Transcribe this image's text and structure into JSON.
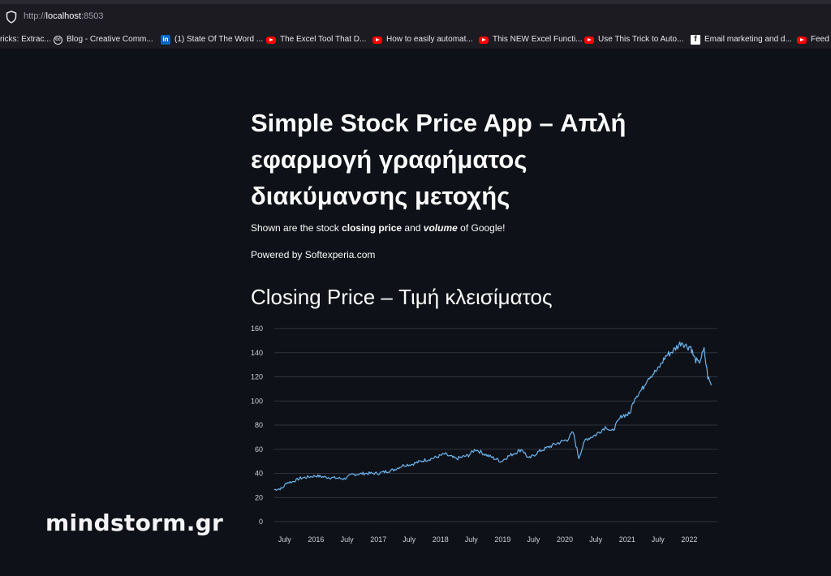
{
  "browser": {
    "url_prefix": "http://",
    "url_host": "localhost",
    "url_port": ":8503",
    "bookmarks": [
      {
        "label": "ricks: Extrac...",
        "icon": "none-icon"
      },
      {
        "label": "Blog - Creative Comm...",
        "icon": "cc-icon"
      },
      {
        "label": "(1) State Of The Word ...",
        "icon": "linkedin-icon"
      },
      {
        "label": "The Excel Tool That D...",
        "icon": "youtube-icon"
      },
      {
        "label": "How to easily automat...",
        "icon": "youtube-icon"
      },
      {
        "label": "This NEW Excel Functi...",
        "icon": "youtube-icon"
      },
      {
        "label": "Use This Trick to Auto...",
        "icon": "youtube-icon"
      },
      {
        "label": "Email marketing and d...",
        "icon": "facebook-icon"
      },
      {
        "label": "Feed Y",
        "icon": "youtube-icon"
      }
    ]
  },
  "app": {
    "title": "Simple Stock Price App – Απλή εφαρμογή γραφήματος διακύμανσης μετοχής",
    "subtitle_parts": {
      "a": "Shown are the stock ",
      "b": "closing price",
      "c": " and ",
      "d": "volume",
      "e": " of Google!"
    },
    "powered_by": "Powered by Softexperia.com",
    "chart_heading": "Closing Price – Τιμή κλεισίματος"
  },
  "watermark": "mindstorm.gr",
  "colors": {
    "line": "#6cb4ee",
    "background": "#0e1117",
    "grid": "#31333f"
  },
  "chart_data": {
    "type": "line",
    "title": "",
    "xlabel": "",
    "ylabel": "",
    "ylim": [
      0,
      160
    ],
    "yticks": [
      0,
      20,
      40,
      60,
      80,
      100,
      120,
      140,
      160
    ],
    "xtick_labels": [
      "July",
      "2016",
      "July",
      "2017",
      "July",
      "2018",
      "July",
      "2019",
      "July",
      "2020",
      "July",
      "2021",
      "July",
      "2022"
    ],
    "xtick_dates": [
      "2015-07-01",
      "2016-01-01",
      "2016-07-01",
      "2017-01-01",
      "2017-07-01",
      "2018-01-01",
      "2018-07-01",
      "2019-01-01",
      "2019-07-01",
      "2020-01-01",
      "2020-07-01",
      "2021-01-01",
      "2021-07-01",
      "2022-01-01"
    ],
    "xlim": [
      "2015-05-01",
      "2022-06-15"
    ],
    "grid": true,
    "series": [
      {
        "x": [
          "2015-05-01",
          "2015-06-15",
          "2015-07-15",
          "2015-08-15",
          "2015-10-01",
          "2016-01-01",
          "2016-02-15",
          "2016-04-01",
          "2016-06-15",
          "2016-08-01",
          "2016-10-15",
          "2017-01-01",
          "2017-04-01",
          "2017-06-01",
          "2017-07-15",
          "2017-10-01",
          "2017-12-01",
          "2018-01-25",
          "2018-04-01",
          "2018-06-15",
          "2018-07-25",
          "2018-10-01",
          "2018-12-24",
          "2019-02-01",
          "2019-04-25",
          "2019-06-03",
          "2019-08-01",
          "2019-11-01",
          "2020-01-15",
          "2020-02-19",
          "2020-03-23",
          "2020-05-01",
          "2020-07-01",
          "2020-09-01",
          "2020-10-01",
          "2020-12-01",
          "2021-01-15",
          "2021-02-15",
          "2021-04-01",
          "2021-05-01",
          "2021-07-01",
          "2021-08-15",
          "2021-10-01",
          "2021-11-18",
          "2021-12-20",
          "2022-01-10",
          "2022-01-28",
          "2022-02-24",
          "2022-03-29",
          "2022-04-20",
          "2022-05-10"
        ],
        "values": [
          26.5,
          27.5,
          32.5,
          33,
          36,
          38,
          37,
          36.5,
          35.5,
          39,
          40,
          40,
          43,
          47,
          47.5,
          51,
          53,
          56,
          52,
          55,
          60,
          55,
          50,
          54,
          60,
          52,
          58,
          64,
          68,
          74,
          53,
          68,
          72,
          79,
          74,
          88,
          89,
          103,
          110,
          119,
          126,
          137,
          142,
          149,
          145,
          145,
          136,
          131,
          142,
          120,
          113
        ]
      }
    ]
  }
}
